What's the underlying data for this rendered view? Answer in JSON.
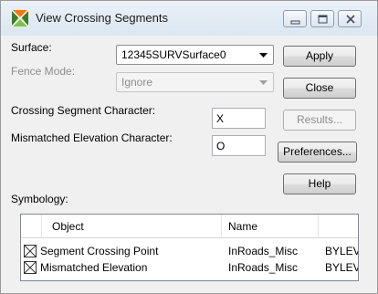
{
  "window": {
    "title": "View Crossing Segments",
    "controls": [
      "minimize-icon",
      "maximize-icon",
      "close-icon"
    ]
  },
  "surface": {
    "label": "Surface:",
    "value": "12345SURVSurface0"
  },
  "fence_mode": {
    "label": "Fence Mode:",
    "value": "Ignore"
  },
  "crossing_segment": {
    "label": "Crossing Segment Character:",
    "value": "X"
  },
  "mismatched_elevation": {
    "label": "Mismatched Elevation Character:",
    "value": "O"
  },
  "buttons": {
    "apply": "Apply",
    "close": "Close",
    "results": "Results...",
    "preferences": "Preferences...",
    "help": "Help"
  },
  "symbology": {
    "label": "Symbology:",
    "columns": [
      "Object",
      "Name",
      ""
    ],
    "rows": [
      {
        "object": "Segment Crossing Point",
        "name": "InRoads_Misc",
        "extra": "BYLEV",
        "checked": true
      },
      {
        "object": "Mismatched Elevation",
        "name": "InRoads_Misc",
        "extra": "BYLEV",
        "checked": true
      }
    ]
  },
  "colors": {
    "titlebar": "#dbe6f1",
    "dialog_bg": "#f0f0f0",
    "disabled_text": "#8d8d8d"
  }
}
